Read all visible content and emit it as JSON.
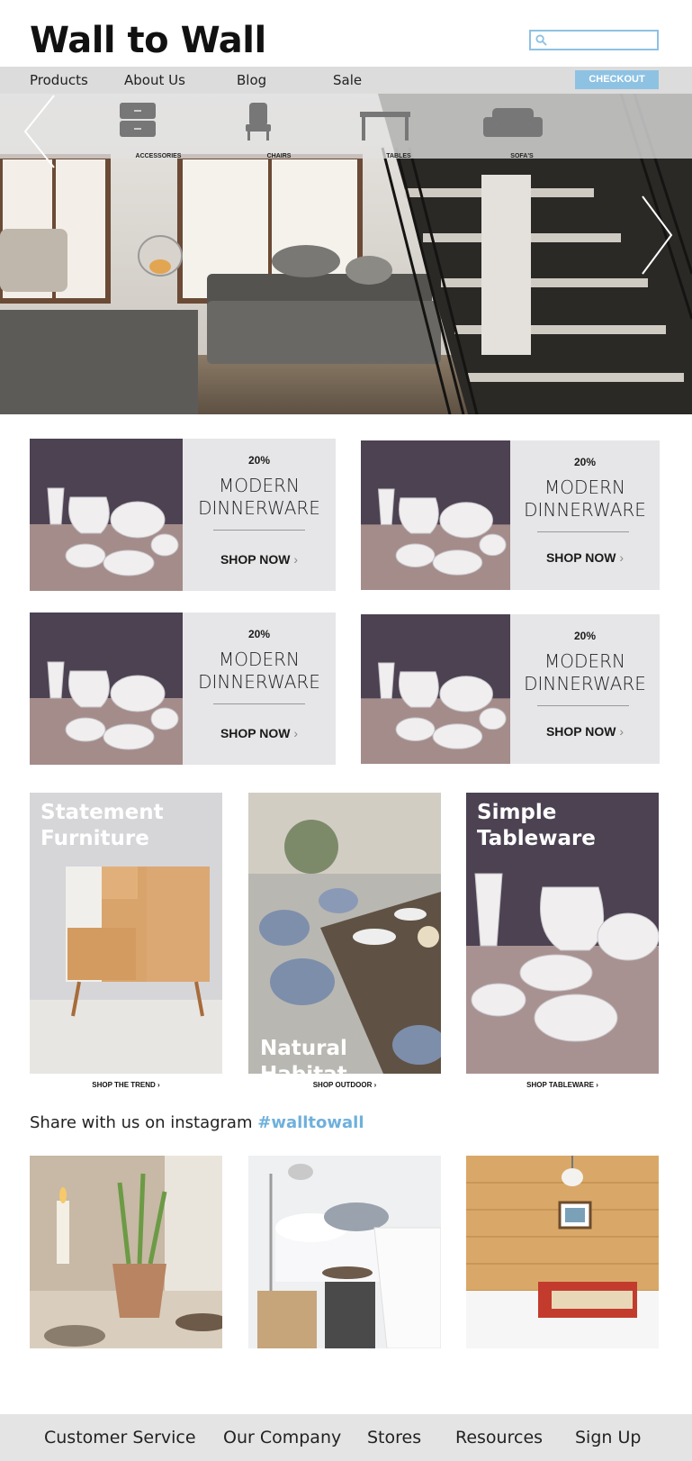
{
  "brand": {
    "name": "Wall to Wall",
    "accent": "#8ec2e3"
  },
  "search": {
    "placeholder": ""
  },
  "nav": {
    "items": [
      "Products",
      "About Us",
      "Blog",
      "Sale"
    ],
    "checkout": "CHECKOUT"
  },
  "hero": {
    "categories": [
      {
        "label": "ACCESSORIES",
        "icon": "dresser-icon"
      },
      {
        "label": "CHAIRS",
        "icon": "chair-icon"
      },
      {
        "label": "TABLES",
        "icon": "table-icon"
      },
      {
        "label": "SOFA'S",
        "icon": "sofa-icon"
      }
    ]
  },
  "promos": [
    {
      "pct": "20%",
      "line1": "MODERN",
      "line2": "DINNERWARE",
      "cta": "SHOP NOW"
    },
    {
      "pct": "20%",
      "line1": "MODERN",
      "line2": "DINNERWARE",
      "cta": "SHOP NOW"
    },
    {
      "pct": "20%",
      "line1": "MODERN",
      "line2": "DINNERWARE",
      "cta": "SHOP NOW"
    },
    {
      "pct": "20%",
      "line1": "MODERN",
      "line2": "DINNERWARE",
      "cta": "SHOP NOW"
    }
  ],
  "collections": [
    {
      "title1": "Statement",
      "title2": "Furniture",
      "link": "SHOP THE TREND"
    },
    {
      "title1": "Natural Habitat",
      "title2": "",
      "link": "SHOP OUTDOOR"
    },
    {
      "title1": "Simple",
      "title2": "Tableware",
      "link": "SHOP TABLEWARE"
    }
  ],
  "instagram": {
    "text": "Share with us on instagram",
    "tag": "#walltowall"
  },
  "footer": {
    "items": [
      "Customer Service",
      "Our Company",
      "Stores",
      "Resources",
      "Sign Up"
    ]
  }
}
